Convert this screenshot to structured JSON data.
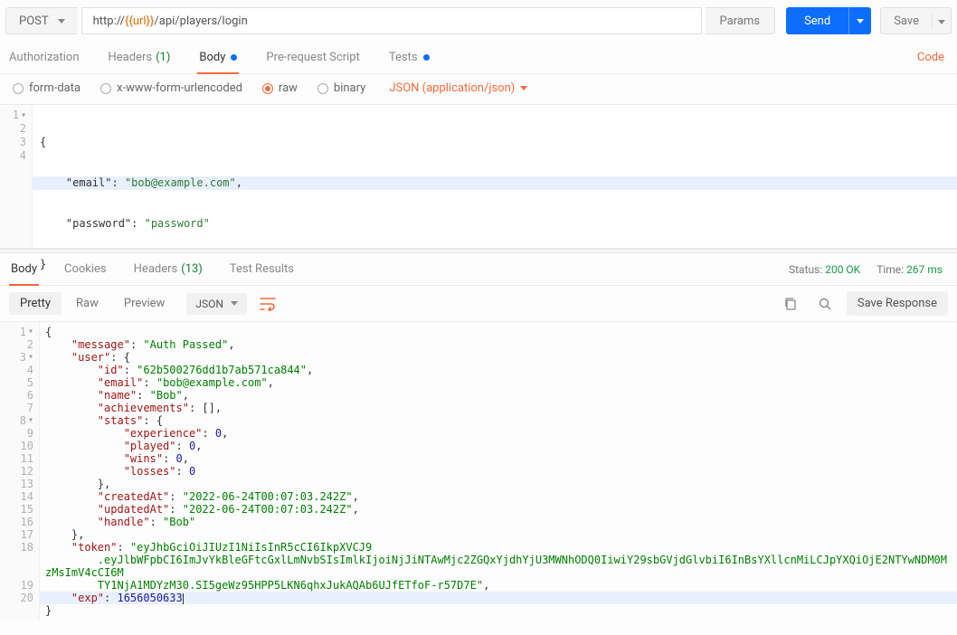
{
  "method": "POST",
  "url": {
    "prefix": "http://",
    "var": "{{url}}",
    "path": "/api/players/login"
  },
  "buttons": {
    "params": "Params",
    "send": "Send",
    "save": "Save"
  },
  "reqTabs": {
    "auth": "Authorization",
    "headers": "Headers",
    "headersCount": "(1)",
    "body": "Body",
    "prereq": "Pre-request Script",
    "tests": "Tests"
  },
  "codeLink": "Code",
  "bodyType": {
    "formdata": "form-data",
    "urlencoded": "x-www-form-urlencoded",
    "raw": "raw",
    "binary": "binary",
    "contentType": "JSON (application/json)"
  },
  "requestBody": {
    "l1": "{",
    "l2_key": "\"email\"",
    "l2_val": "\"bob@example.com\"",
    "l3_key": "\"password\"",
    "l3_val": "\"password\"",
    "l4": "}"
  },
  "respTabs": {
    "body": "Body",
    "cookies": "Cookies",
    "headers": "Headers",
    "headersCount": "(13)",
    "testresults": "Test Results"
  },
  "status": {
    "label": "Status:",
    "value": "200 OK",
    "timeLabel": "Time:",
    "timeValue": "267 ms"
  },
  "respView": {
    "pretty": "Pretty",
    "raw": "Raw",
    "preview": "Preview",
    "fmt": "JSON",
    "save": "Save Response"
  },
  "resp": {
    "message": "Auth Passed",
    "user": {
      "id": "62b500276dd1b7ab571ca844",
      "email": "bob@example.com",
      "name": "Bob",
      "achievementsRaw": "[]",
      "stats": {
        "experience": 0,
        "played": 0,
        "wins": 0,
        "losses": 0
      },
      "createdAt": "2022-06-24T00:07:03.242Z",
      "updatedAt": "2022-06-24T00:07:03.242Z",
      "handle": "Bob"
    },
    "tokenPart1": "eyJhbGciOiJIUzI1NiIsInR5cCI6IkpXVCJ9",
    "tokenPart2": ".eyJlbWFpbCI6ImJvYkBleGFtcGxlLmNvbSIsImlkIjoiNjJiNTAwMjc2ZGQxYjdhYjU3MWNhODQ0IiwiY29sbGVjdGlvbiI6InBsYXllcnMiLCJpYXQiOjE2NTYwNDM0MzMsImV4cCI6M",
    "tokenPart3": "TY1NjA1MDYzM30.SI5geWz95HPP5LKN6qhxJukAQAb6UJfETfoF-r57D7E",
    "exp": 1656050633
  }
}
